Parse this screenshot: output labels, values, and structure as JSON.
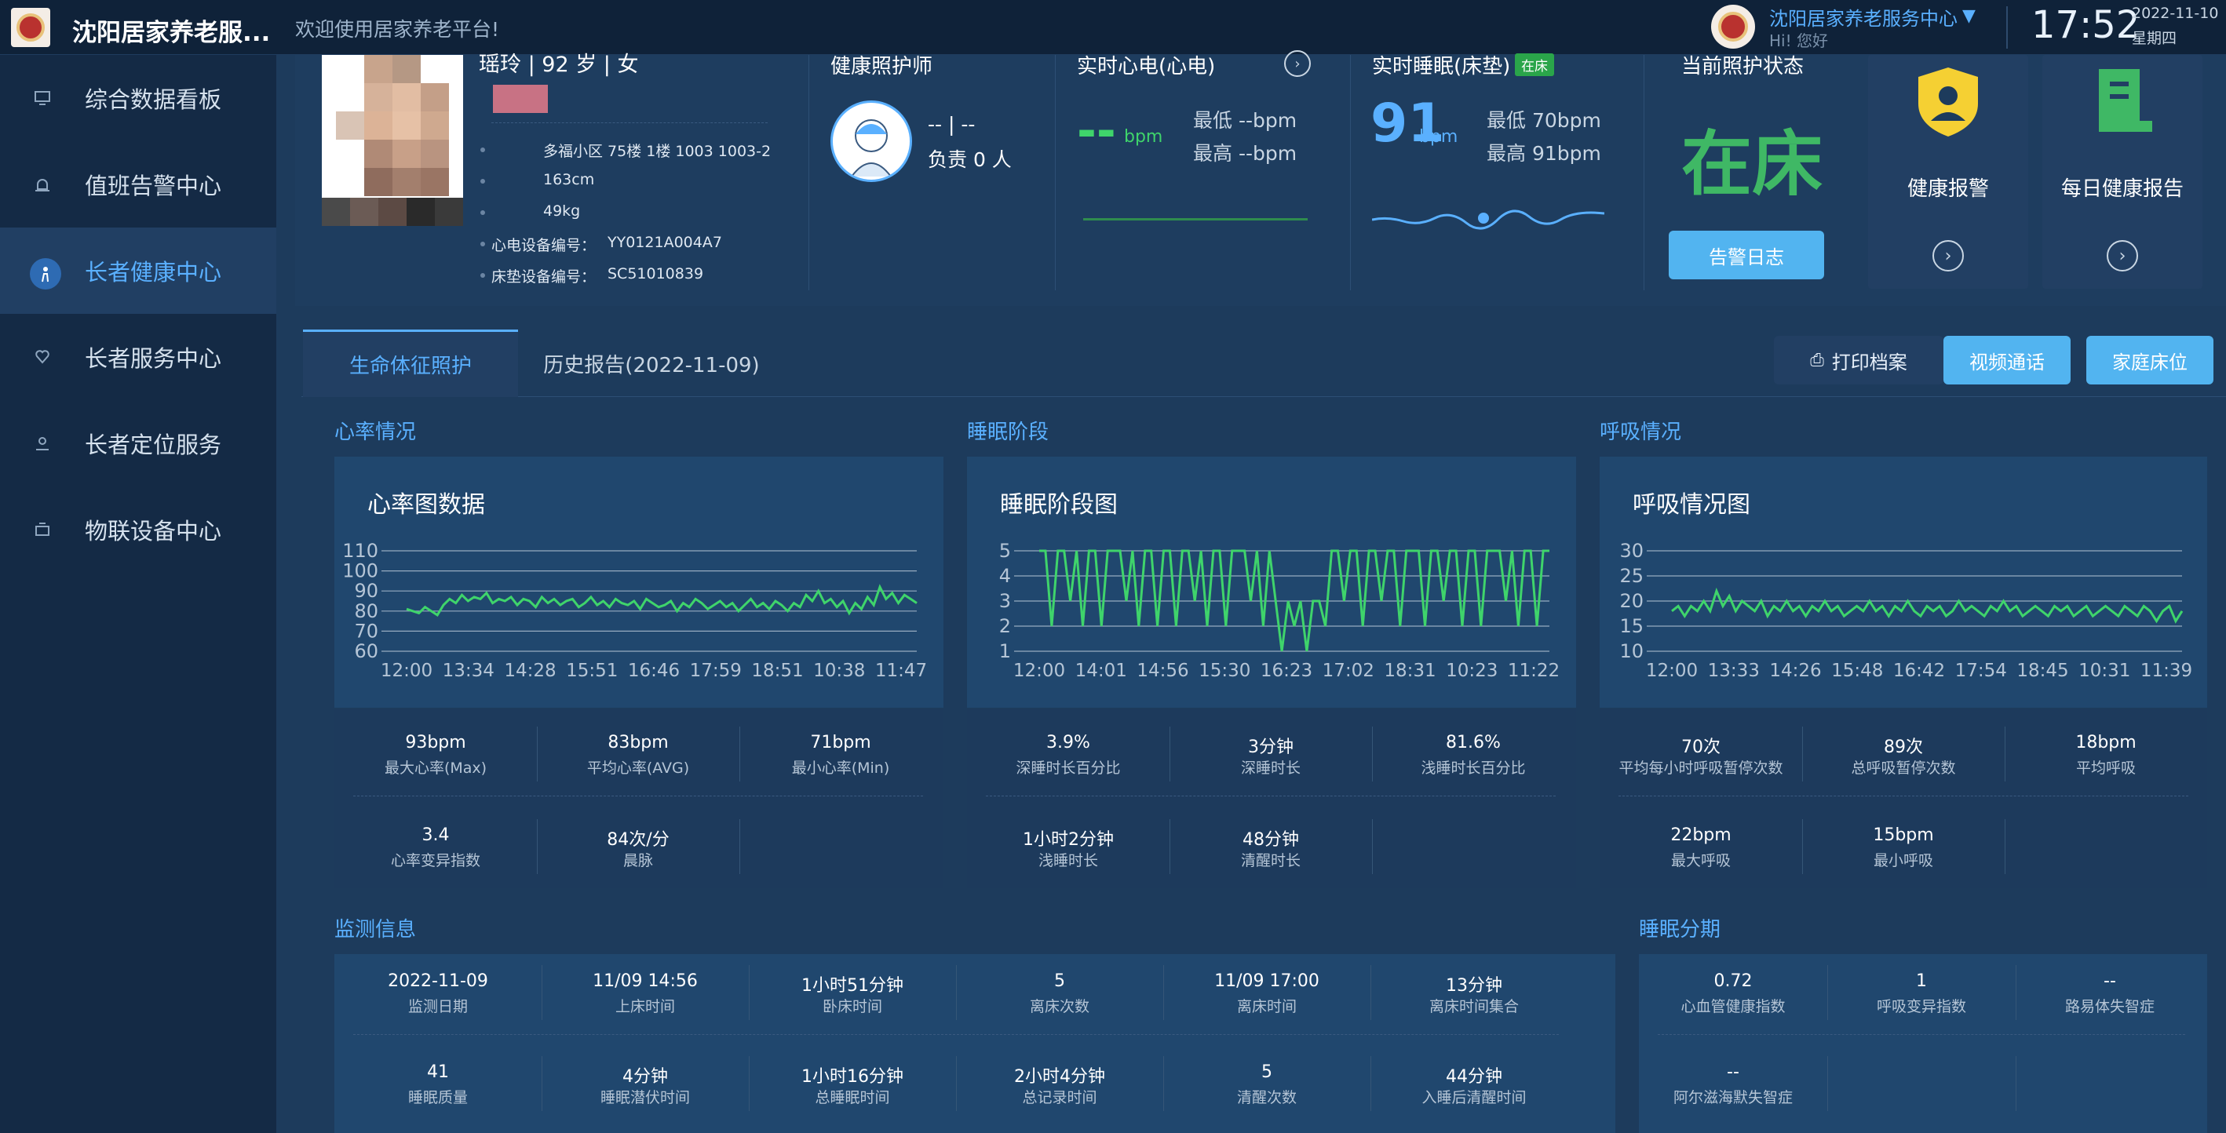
{
  "header": {
    "app_title": "沈阳居家养老服...",
    "welcome": "欢迎使用居家养老平台!",
    "user_name": "沈阳居家养老服务中心",
    "user_greeting": "Hi! 您好",
    "time": "17:52",
    "date": "2022-11-10",
    "weekday": "星期四"
  },
  "sidebar": {
    "items": [
      {
        "label": "综合数据看板",
        "icon": "monitor-icon",
        "active": false
      },
      {
        "label": "值班告警中心",
        "icon": "alarm-icon",
        "active": false
      },
      {
        "label": "长者健康中心",
        "icon": "elder-icon",
        "active": true
      },
      {
        "label": "长者服务中心",
        "icon": "heart-hand-icon",
        "active": false
      },
      {
        "label": "长者定位服务",
        "icon": "location-icon",
        "active": false
      },
      {
        "label": "物联设备中心",
        "icon": "device-icon",
        "active": false
      }
    ]
  },
  "profile": {
    "name_age_gender": "瑶玲 | 92 岁 | 女",
    "address": "多福小区 75楼 1楼 1003 1003-2",
    "height": "163cm",
    "weight": "49kg",
    "ecg_device_label": "心电设备编号：",
    "ecg_device": "YY0121A004A7",
    "mattress_device_label": "床垫设备编号：",
    "mattress_device": "SC51010839"
  },
  "caregiver": {
    "title": "健康照护师",
    "name": "-- | --",
    "count": "负责 0 人"
  },
  "ecg": {
    "title": "实时心电(心电)",
    "value": "--",
    "unit": "bpm",
    "min": "最低 --bpm",
    "max": "最高 --bpm"
  },
  "sleep_realtime": {
    "title": "实时睡眠(床垫)",
    "badge": "在床",
    "value": "91",
    "unit": "bpm",
    "min": "最低 70bpm",
    "max": "最高 91bpm"
  },
  "care_status": {
    "title": "当前照护状态",
    "status": "在床",
    "log_button": "告警日志"
  },
  "cards": {
    "health_alarm": "健康报警",
    "daily_report": "每日健康报告"
  },
  "tabs": {
    "vital": "生命体征照护",
    "history": "历史报告(2022-11-09)"
  },
  "actions": {
    "print": "打印档案",
    "video": "视频通话",
    "bed": "家庭床位"
  },
  "sections": {
    "heart": "心率情况",
    "sleep": "睡眠阶段",
    "breath": "呼吸情况",
    "monitor": "监测信息",
    "sleep_phase": "睡眠分期"
  },
  "colors": {
    "accent": "#5ab0ff",
    "green": "#3fd46b",
    "sidebar_bg": "#142a45",
    "main_bg": "#1d3b5c"
  },
  "chart_data": [
    {
      "type": "line",
      "title": "心率图数据",
      "y_ticks": [
        110,
        100,
        90,
        80,
        70,
        60
      ],
      "ylim": [
        60,
        110
      ],
      "x_ticks": [
        "12:00",
        "13:34",
        "14:28",
        "15:51",
        "16:46",
        "17:59",
        "18:51",
        "10:38",
        "11:47"
      ],
      "series": [
        {
          "values": [
            81,
            80,
            79,
            82,
            80,
            78,
            83,
            86,
            84,
            88,
            85,
            87,
            86,
            89,
            84,
            86,
            85,
            87,
            83,
            86,
            85,
            82,
            87,
            84,
            86,
            83,
            85,
            86,
            82,
            84,
            87,
            83,
            85,
            82,
            86,
            84,
            83,
            85,
            81,
            86,
            84,
            82,
            83,
            85,
            80,
            84,
            82,
            86,
            84,
            81,
            83,
            85,
            82,
            84,
            80,
            83,
            86,
            82,
            84,
            81,
            85,
            83,
            80,
            84,
            82,
            88,
            85,
            90,
            84,
            86,
            82,
            85,
            79,
            84,
            81,
            87,
            83,
            92,
            86,
            89,
            84,
            88,
            86,
            84
          ]
        }
      ]
    },
    {
      "type": "line",
      "title": "睡眠阶段图",
      "y_ticks": [
        5,
        4,
        3,
        2,
        1
      ],
      "ylim": [
        1,
        5
      ],
      "x_ticks": [
        "12:00",
        "14:01",
        "14:56",
        "15:30",
        "16:23",
        "17:02",
        "18:31",
        "10:23",
        "11:22"
      ],
      "series": [
        {
          "values": [
            5,
            5,
            2,
            5,
            5,
            3,
            5,
            2,
            5,
            5,
            2,
            5,
            5,
            5,
            3,
            5,
            2,
            5,
            5,
            2,
            5,
            5,
            2,
            5,
            5,
            3,
            5,
            2,
            5,
            5,
            2,
            5,
            5,
            5,
            3,
            5,
            2,
            5,
            3,
            1,
            3,
            2,
            3,
            1,
            3,
            3,
            2,
            5,
            5,
            3,
            5,
            5,
            2,
            5,
            5,
            3,
            5,
            5,
            2,
            5,
            5,
            5,
            2,
            5,
            5,
            3,
            5,
            5,
            2,
            5,
            5,
            2,
            5,
            5,
            5,
            3,
            5,
            2,
            5,
            5,
            2,
            5,
            5
          ]
        }
      ]
    },
    {
      "type": "line",
      "title": "呼吸情况图",
      "y_ticks": [
        30,
        25,
        20,
        15,
        10
      ],
      "ylim": [
        10,
        30
      ],
      "x_ticks": [
        "12:00",
        "13:33",
        "14:26",
        "15:48",
        "16:42",
        "17:54",
        "18:45",
        "10:31",
        "11:39"
      ],
      "series": [
        {
          "values": [
            18,
            19,
            17,
            19,
            18,
            20,
            18,
            22,
            19,
            21,
            18,
            20,
            19,
            18,
            20,
            17,
            19,
            18,
            20,
            18,
            19,
            17,
            19,
            18,
            20,
            18,
            19,
            17,
            18,
            19,
            18,
            20,
            18,
            19,
            17,
            19,
            18,
            20,
            18,
            17,
            19,
            18,
            19,
            17,
            18,
            20,
            18,
            19,
            18,
            17,
            19,
            18,
            20,
            18,
            19,
            17,
            18,
            19,
            18,
            17,
            19,
            18,
            19,
            17,
            18,
            19,
            17,
            18,
            19,
            18,
            17,
            19,
            18,
            17,
            19,
            18,
            16,
            18,
            19,
            16,
            18
          ]
        }
      ]
    }
  ],
  "heart_stats": [
    {
      "value": "93bpm",
      "label": "最大心率(Max)"
    },
    {
      "value": "83bpm",
      "label": "平均心率(AVG)"
    },
    {
      "value": "71bpm",
      "label": "最小心率(Min)"
    },
    {
      "value": "3.4",
      "label": "心率变异指数"
    },
    {
      "value": "84次/分",
      "label": "晨脉"
    }
  ],
  "sleep_stats": [
    {
      "value": "3.9%",
      "label": "深睡时长百分比"
    },
    {
      "value": "3分钟",
      "label": "深睡时长"
    },
    {
      "value": "81.6%",
      "label": "浅睡时长百分比"
    },
    {
      "value": "1小时2分钟",
      "label": "浅睡时长"
    },
    {
      "value": "48分钟",
      "label": "清醒时长"
    }
  ],
  "breath_stats": [
    {
      "value": "70次",
      "label": "平均每小时呼吸暂停次数"
    },
    {
      "value": "89次",
      "label": "总呼吸暂停次数"
    },
    {
      "value": "18bpm",
      "label": "平均呼吸"
    },
    {
      "value": "22bpm",
      "label": "最大呼吸"
    },
    {
      "value": "15bpm",
      "label": "最小呼吸"
    }
  ],
  "monitor_stats": [
    {
      "value": "2022-11-09",
      "label": "监测日期"
    },
    {
      "value": "11/09 14:56",
      "label": "上床时间"
    },
    {
      "value": "1小时51分钟",
      "label": "卧床时间"
    },
    {
      "value": "5",
      "label": "离床次数"
    },
    {
      "value": "11/09 17:00",
      "label": "离床时间"
    },
    {
      "value": "13分钟",
      "label": "离床时间集合"
    },
    {
      "value": "41",
      "label": "睡眠质量"
    },
    {
      "value": "4分钟",
      "label": "睡眠潜伏时间"
    },
    {
      "value": "1小时16分钟",
      "label": "总睡眠时间"
    },
    {
      "value": "2小时4分钟",
      "label": "总记录时间"
    },
    {
      "value": "5",
      "label": "清醒次数"
    },
    {
      "value": "44分钟",
      "label": "入睡后清醒时间"
    }
  ],
  "sleep_phase_stats": [
    {
      "value": "0.72",
      "label": "心血管健康指数"
    },
    {
      "value": "1",
      "label": "呼吸变异指数"
    },
    {
      "value": "--",
      "label": "路易体失智症"
    },
    {
      "value": "--",
      "label": "阿尔滋海默失智症"
    }
  ]
}
